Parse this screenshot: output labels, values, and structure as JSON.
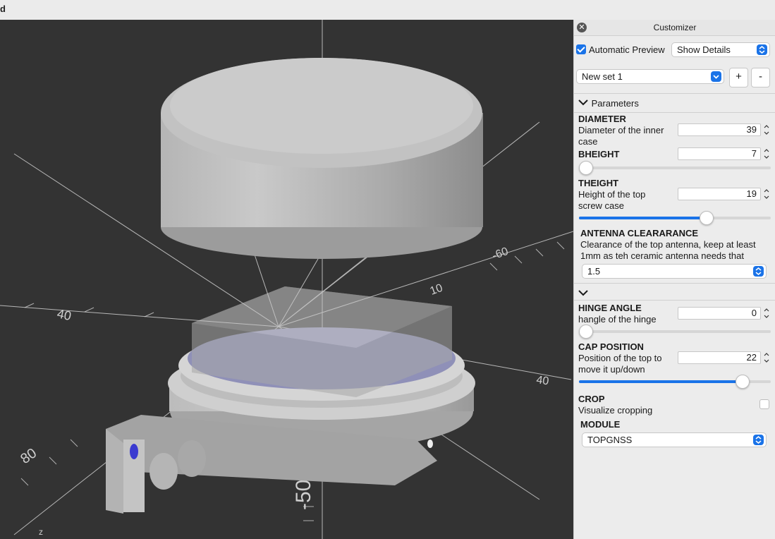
{
  "window": {
    "title_fragment": "d"
  },
  "viewport": {
    "axis_labels": [
      "40",
      "-50",
      "80",
      "-60",
      "10",
      "40",
      "z"
    ]
  },
  "customizer": {
    "title": "Customizer",
    "automatic_preview": {
      "label": "Automatic Preview",
      "checked": true
    },
    "details_select": "Show Details",
    "preset": "New set 1",
    "add_label": "+",
    "remove_label": "-",
    "parameters_header": "Parameters",
    "params": {
      "diameter": {
        "name": "DIAMETER",
        "desc_1": "Diameter of the inner",
        "desc_2": "case",
        "value": "39"
      },
      "bheight": {
        "name": "BHEIGHT",
        "value": "7",
        "slider_fraction": 0.0
      },
      "theight": {
        "name": "THEIGHT",
        "desc_1": "Height of the top",
        "desc_2": "screw case",
        "value": "19",
        "slider_fraction": 0.68
      },
      "antenna": {
        "name": "ANTENNA CLEARARANCE",
        "desc_1": "Clearance of the top antenna, keep at least",
        "desc_2": "1mm as teh ceramic antenna needs that",
        "value": "1.5"
      },
      "hinge": {
        "name": "HINGE ANGLE",
        "desc": "hangle of the hinge",
        "value": "0",
        "slider_fraction": 0.0
      },
      "cap": {
        "name": "CAP POSITION",
        "desc_1": "Position of the top to",
        "desc_2": "move it up/down",
        "value": "22",
        "slider_fraction": 0.88
      },
      "crop": {
        "name": "CROP",
        "desc": "Visualize cropping",
        "checked": false
      },
      "module": {
        "name": "MODULE",
        "value": "TOPGNSS"
      }
    }
  },
  "colors": {
    "accent": "#1a73e8",
    "viewport_bg": "#333333",
    "panel_bg": "#ececec"
  }
}
